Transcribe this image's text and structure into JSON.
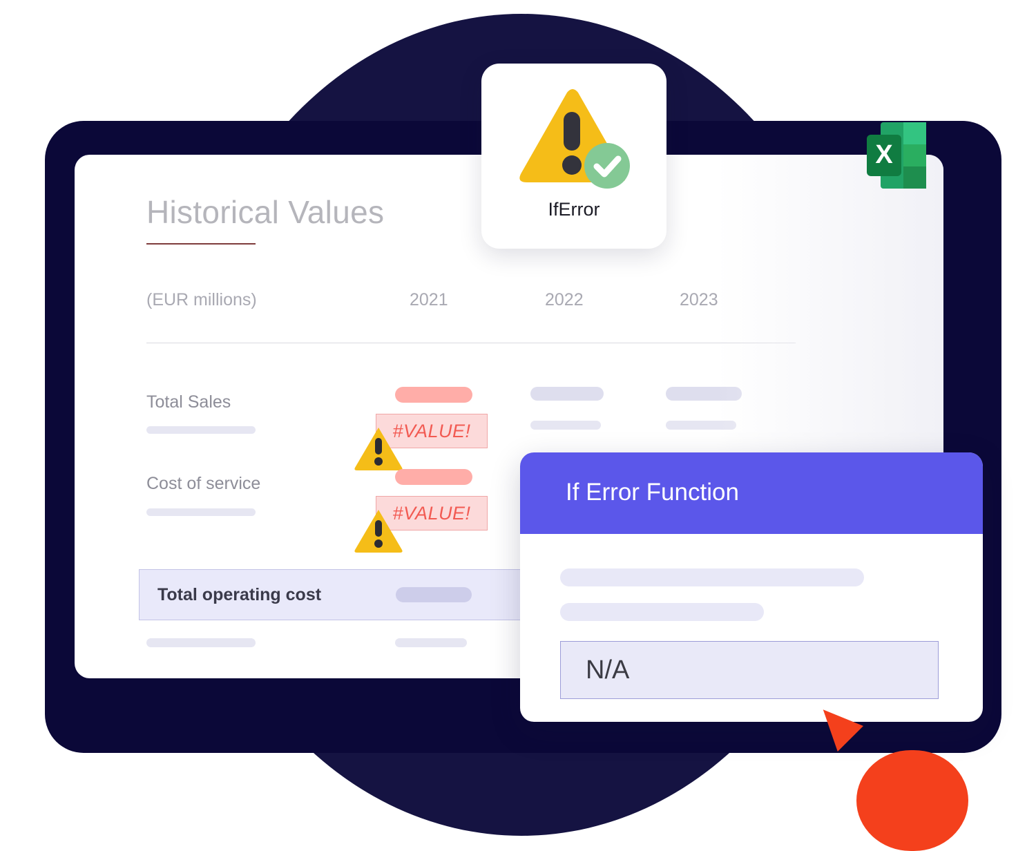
{
  "theme": {
    "navy_dark": "#0b0838",
    "navy_circle": "#151342",
    "accent_purple": "#5b57ea",
    "accent_orange": "#f4401c",
    "error_red": "#f25a52",
    "error_bg": "#fcdada",
    "salmon": "#ffada8",
    "lavender": "#dedeee",
    "title_grey": "#b5b5bb",
    "rule_maroon": "#7e3b3b",
    "warning_yellow": "#f5bd18",
    "success_green": "#84c995",
    "excel_green": "#21a366"
  },
  "sheet": {
    "title": "Historical Values",
    "table": {
      "headers": [
        "(EUR millions)",
        "2021",
        "2022",
        "2023"
      ],
      "rows": [
        {
          "label": "Total Sales",
          "cells_2021": {
            "bar": true,
            "error": "#VALUE!",
            "has_warning_icon": true
          },
          "cells_2022": {
            "bar": true
          },
          "cells_2023": {
            "bar": true
          }
        },
        {
          "label": "Cost of service",
          "cells_2021": {
            "bar": true,
            "error": "#VALUE!",
            "has_warning_icon": true
          },
          "cells_2022": {
            "bar": true
          },
          "cells_2023": {
            "bar": true
          }
        },
        {
          "label": "Total operating cost",
          "highlighted": true,
          "cells_2021": {
            "bar": true
          },
          "cells_2022": {
            "bar": true
          },
          "cells_2023": {
            "bar": true
          }
        }
      ]
    }
  },
  "iferror_badge": {
    "label": "IfError",
    "warning_icon": "warning-triangle-icon",
    "status_icon": "check-circle-icon"
  },
  "excel": {
    "icon": "excel-app-icon",
    "letter": "X"
  },
  "dialog": {
    "title": "If Error Function",
    "input_value": "N/A",
    "placeholder_lines": 2
  }
}
